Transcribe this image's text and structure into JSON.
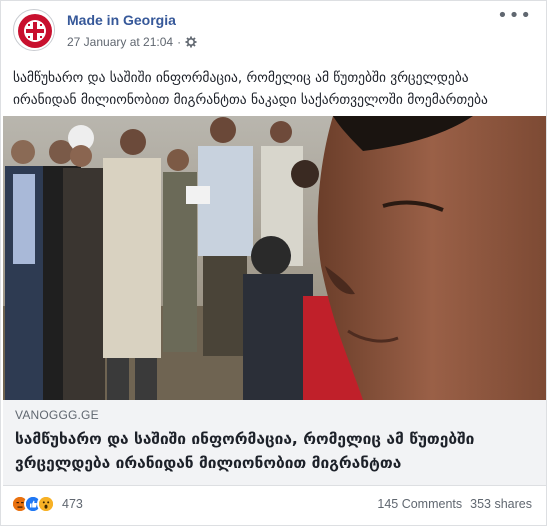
{
  "header": {
    "page_name": "Made in Georgia",
    "timestamp": "27 January at 21:04",
    "separator": "·",
    "avatar_icon": "made-in-georgia-logo",
    "privacy_icon": "gear-icon",
    "more_label": "•••"
  },
  "post": {
    "text": "სამწუხარო და საშიში ინფორმაცია, რომელიც ამ წუთებში ვრცელდება ირანიდან მილიონობით მიგრანტთა ნაკადი საქართველოში მოემართება"
  },
  "link_card": {
    "domain": "VANOGGG.GE",
    "title": "სამწუხარო და საშიში ინფორმაცია, რომელიც ამ წუთებში ვრცელდება ირანიდან მილიონობით მიგრანტთა"
  },
  "footer": {
    "reactions": [
      "angry",
      "like",
      "wow"
    ],
    "reaction_count": "473",
    "comments": "145 Comments",
    "shares": "353 shares"
  },
  "colors": {
    "link_blue": "#365899",
    "meta_grey": "#606770",
    "card_bg": "#f2f3f5",
    "avatar_red": "#c8102e"
  }
}
